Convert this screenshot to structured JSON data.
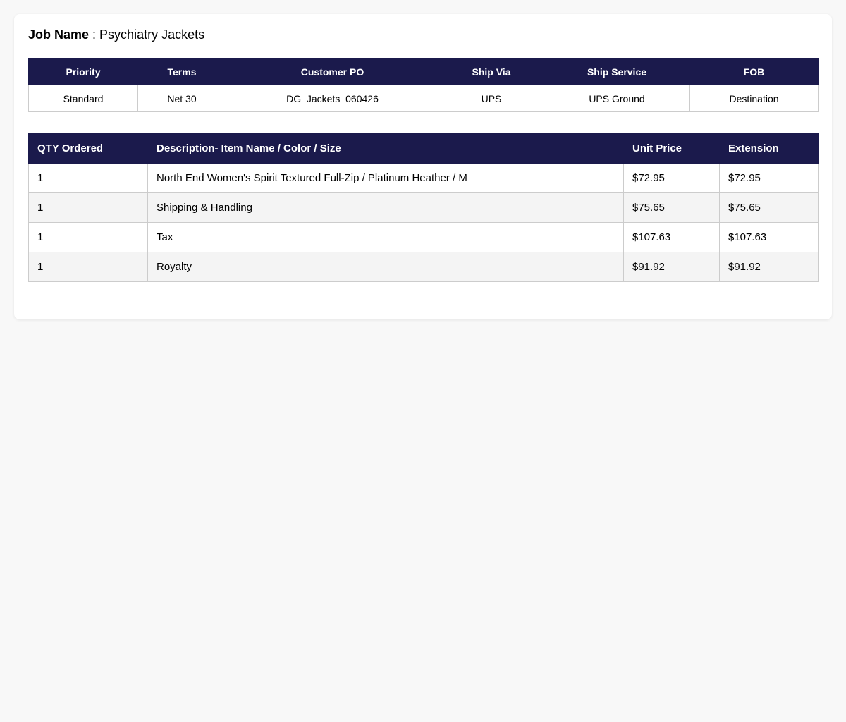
{
  "job": {
    "label": "Job Name",
    "separator": " : ",
    "value": "Psychiatry Jackets"
  },
  "order_info": {
    "headers": [
      "Priority",
      "Terms",
      "Customer PO",
      "Ship Via",
      "Ship Service",
      "FOB"
    ],
    "values": [
      "Standard",
      "Net 30",
      "DG_Jackets_060426",
      "UPS",
      "UPS Ground",
      "Destination"
    ]
  },
  "line_items": {
    "headers": [
      "QTY Ordered",
      "Description- Item Name / Color / Size",
      "Unit Price",
      "Extension"
    ],
    "rows": [
      [
        "1",
        "North End Women's Spirit Textured Full-Zip / Platinum Heather / M",
        "$72.95",
        "$72.95"
      ],
      [
        "1",
        "Shipping & Handling",
        "$75.65",
        "$75.65"
      ],
      [
        "1",
        "Tax",
        "$107.63",
        "$107.63"
      ],
      [
        "1",
        "Royalty",
        "$91.92",
        "$91.92"
      ]
    ]
  },
  "colors": {
    "header_bg": "#1b1a4c",
    "row_alt_bg": "#f4f4f4",
    "page_bg": "#f8f8f8"
  }
}
